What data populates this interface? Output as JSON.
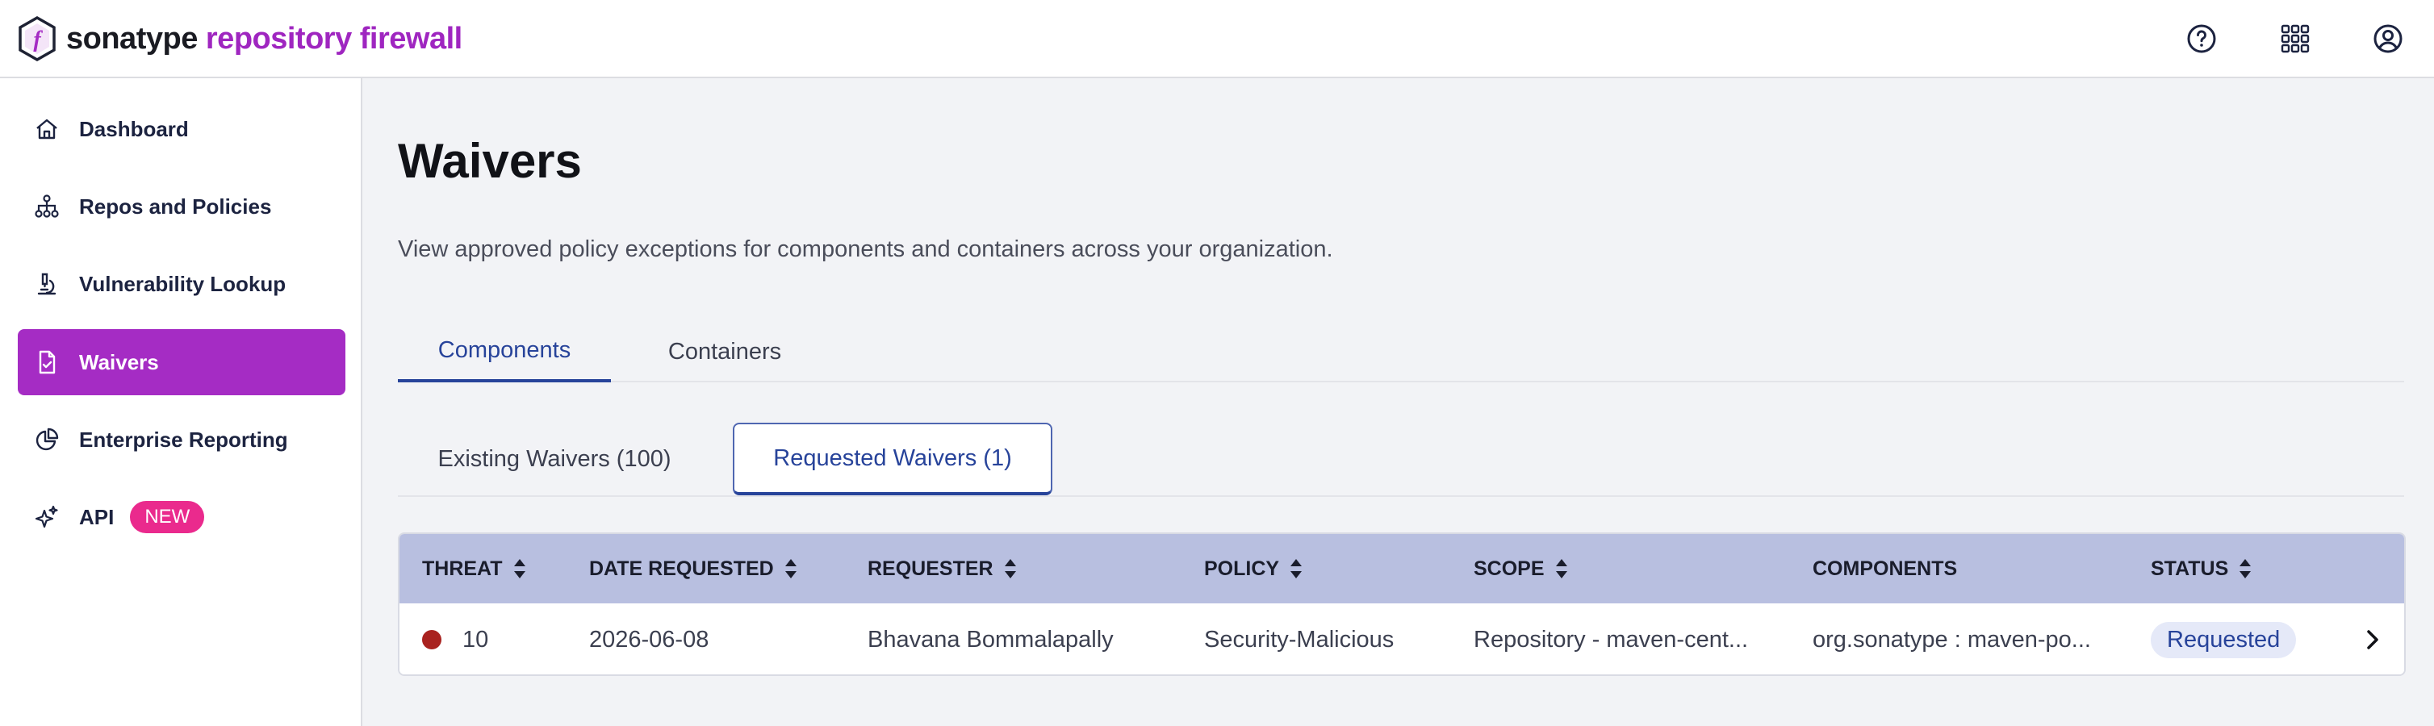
{
  "header": {
    "brand": "sonatype",
    "product": "repository firewall",
    "icons": [
      "help-icon",
      "apps-grid-icon",
      "user-account-icon"
    ]
  },
  "sidebar": {
    "items": [
      {
        "label": "Dashboard",
        "icon": "home-icon"
      },
      {
        "label": "Repos and Policies",
        "icon": "hierarchy-icon"
      },
      {
        "label": "Vulnerability Lookup",
        "icon": "microscope-icon"
      },
      {
        "label": "Waivers",
        "icon": "document-check-icon",
        "active": true
      },
      {
        "label": "Enterprise Reporting",
        "icon": "pie-chart-icon"
      },
      {
        "label": "API",
        "icon": "sparkle-icon",
        "badge": "NEW"
      }
    ]
  },
  "page": {
    "title": "Waivers",
    "description": "View approved policy exceptions for components and containers across your organization."
  },
  "tabs": [
    {
      "label": "Components",
      "active": true
    },
    {
      "label": "Containers",
      "active": false
    }
  ],
  "subtabs": [
    {
      "label": "Existing Waivers (100)",
      "active": false
    },
    {
      "label": "Requested Waivers (1)",
      "active": true
    }
  ],
  "table": {
    "columns": [
      "THREAT",
      "DATE REQUESTED",
      "REQUESTER",
      "POLICY",
      "SCOPE",
      "COMPONENTS",
      "STATUS"
    ],
    "rows": [
      {
        "threat": "10",
        "threat_color": "#a9221f",
        "date_requested": "2026-06-08",
        "requester": "Bhavana Bommalapally",
        "policy": "Security-Malicious",
        "scope": "Repository - maven-cent...",
        "components": "org.sonatype : maven-po...",
        "status": "Requested"
      }
    ]
  },
  "colors": {
    "accent": "#a52cc4",
    "primary_blue": "#27439a",
    "table_header": "#b8bfe0",
    "badge_new": "#ea2a8d"
  }
}
